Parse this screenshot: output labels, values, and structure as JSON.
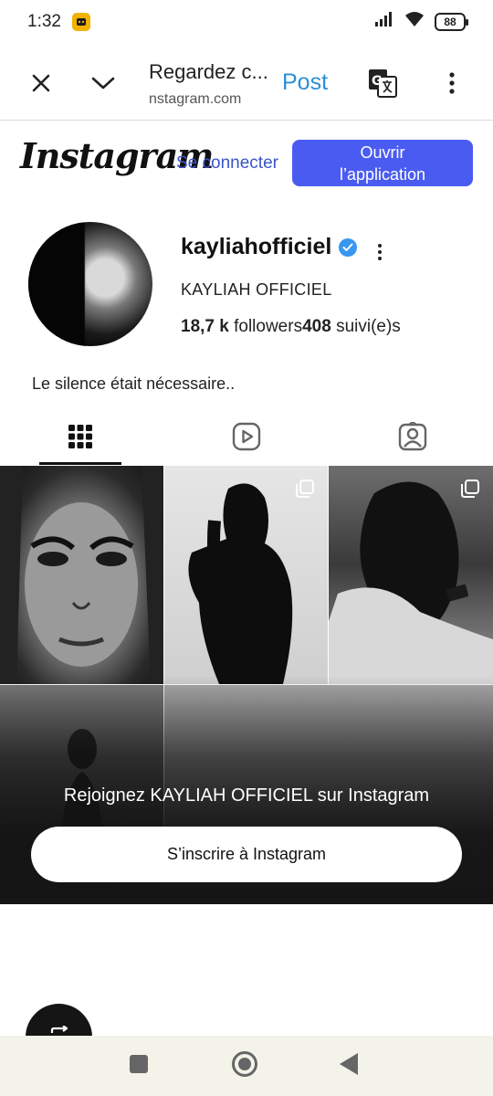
{
  "status_bar": {
    "time": "1:32",
    "battery": "88",
    "icons": [
      "app-notification-icon",
      "signal-icon",
      "wifi-icon",
      "battery-icon"
    ]
  },
  "toolbar": {
    "title": "Regardez c...",
    "url": "nstagram.com",
    "post_label": "Post",
    "icons": [
      "close-icon",
      "chevron-down-icon",
      "translate-icon",
      "more-vertical-icon"
    ]
  },
  "instagram": {
    "logo_text": "Instagram",
    "login_label": "Se connecter",
    "open_app_label_line1": "Ouvrir",
    "open_app_label_line2": "l’application",
    "accent_color": "#4a5bf2"
  },
  "profile": {
    "username": "kayliahofficiel",
    "full_name": "KAYLIAH OFFICIEL",
    "followers_count": "18,7 k",
    "followers_label": "followers",
    "following_count": "408",
    "following_label": "suivi(e)s",
    "bio": "Le silence était nécessaire..",
    "verified_color": "#3897f0"
  },
  "tabs": [
    {
      "name": "grid",
      "icon": "grid-icon",
      "active": true
    },
    {
      "name": "reels",
      "icon": "reels-icon",
      "active": false
    },
    {
      "name": "tagged",
      "icon": "tagged-icon",
      "active": false
    }
  ],
  "grid": {
    "join_text": "Rejoignez KAYLIAH OFFICIEL sur Instagram",
    "signup_label": "S’inscrire à Instagram"
  },
  "nav": {
    "icons": [
      "recents-icon",
      "home-icon",
      "back-icon",
      "rotate-icon"
    ]
  }
}
